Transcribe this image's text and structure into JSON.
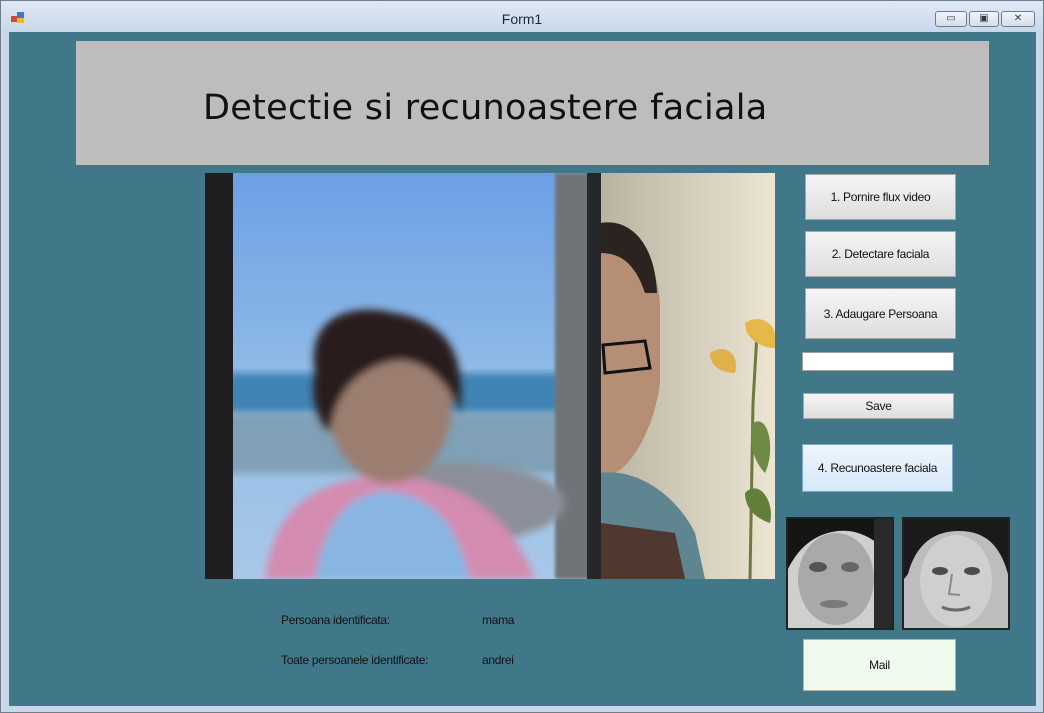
{
  "window": {
    "title": "Form1",
    "minimize_glyph": "▭",
    "maximize_glyph": "▣",
    "close_glyph": "✕"
  },
  "header": {
    "title": "Detectie si recunoastere faciala"
  },
  "buttons": {
    "start_video": "1. Pornire flux video",
    "detect_face": "2. Detectare faciala",
    "add_person": "3. Adaugare Persoana",
    "save": "Save",
    "recognize": "4. Recunoastere faciala",
    "mail": "Mail"
  },
  "name_input": {
    "value": "",
    "placeholder": ""
  },
  "results": {
    "identified_label": "Persoana identificata:",
    "identified_value": "mama",
    "all_label": "Toate persoanele identificate:",
    "all_value": "andrei"
  },
  "colors": {
    "client_background": "#40788a",
    "header_panel": "#bdbdbd"
  }
}
